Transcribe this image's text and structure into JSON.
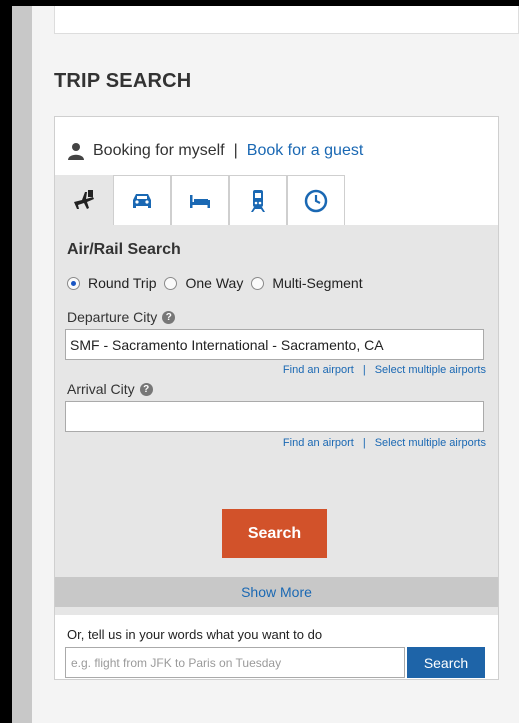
{
  "section_title": "TRIP SEARCH",
  "booking": {
    "myself_label": "Booking for myself",
    "separator": "|",
    "guest_label": "Book for a guest"
  },
  "tabs": [
    {
      "icon": "flight-icon",
      "active": true
    },
    {
      "icon": "car-icon",
      "active": false
    },
    {
      "icon": "hotel-bed-icon",
      "active": false
    },
    {
      "icon": "train-icon",
      "active": false
    },
    {
      "icon": "clock-icon",
      "active": false
    }
  ],
  "form": {
    "title": "Air/Rail Search",
    "trip_types": [
      {
        "label": "Round Trip",
        "selected": true
      },
      {
        "label": "One Way",
        "selected": false
      },
      {
        "label": "Multi-Segment",
        "selected": false
      }
    ],
    "departure": {
      "label": "Departure City",
      "value": "SMF - Sacramento International - Sacramento, CA"
    },
    "arrival": {
      "label": "Arrival City",
      "value": ""
    },
    "find_airport_link": "Find an airport",
    "link_separator": "|",
    "multiple_airports_link": "Select multiple airports",
    "help_glyph": "?",
    "search_button": "Search",
    "show_more": "Show More"
  },
  "natural_language": {
    "label": "Or, tell us in your words what you want to do",
    "placeholder": "e.g. flight from JFK to Paris on Tuesday",
    "button": "Search"
  },
  "colors": {
    "search_orange": "#d2522a",
    "link_blue": "#1a68b3",
    "nl_button_blue": "#1e64a8",
    "form_gray": "#e6e6e6"
  }
}
